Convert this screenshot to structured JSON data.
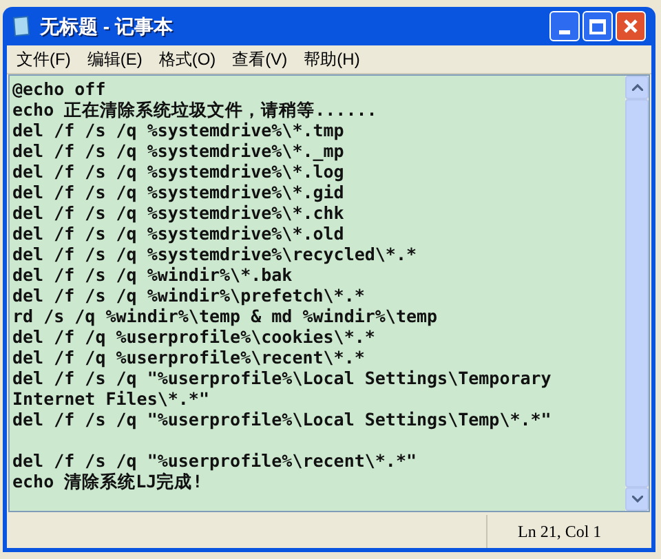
{
  "window": {
    "title": "无标题 - 记事本"
  },
  "menu": [
    {
      "label": "文件(F)"
    },
    {
      "label": "编辑(E)"
    },
    {
      "label": "格式(O)"
    },
    {
      "label": "查看(V)"
    },
    {
      "label": "帮助(H)"
    }
  ],
  "editor": {
    "lines": [
      {
        "kind": "code",
        "text": "@echo off"
      },
      {
        "kind": "code",
        "text": "echo 正在清除系统垃圾文件，请稍等......"
      },
      {
        "kind": "code",
        "text": "del /f /s /q %systemdrive%\\*.tmp"
      },
      {
        "kind": "code",
        "text": "del /f /s /q %systemdrive%\\*._mp"
      },
      {
        "kind": "code",
        "text": "del /f /s /q %systemdrive%\\*.log"
      },
      {
        "kind": "code",
        "text": "del /f /s /q %systemdrive%\\*.gid"
      },
      {
        "kind": "code",
        "text": "del /f /s /q %systemdrive%\\*.chk"
      },
      {
        "kind": "code",
        "text": "del /f /s /q %systemdrive%\\*.old"
      },
      {
        "kind": "code",
        "text": "del /f /s /q %systemdrive%\\recycled\\*.*"
      },
      {
        "kind": "code",
        "text": "del /f /s /q %windir%\\*.bak"
      },
      {
        "kind": "code",
        "text": "del /f /s /q %windir%\\prefetch\\*.*"
      },
      {
        "kind": "code",
        "text": "rd /s /q %windir%\\temp & md %windir%\\temp"
      },
      {
        "kind": "code",
        "text": "del /f /q %userprofile%\\cookies\\*.*"
      },
      {
        "kind": "code",
        "text": "del /f /q %userprofile%\\recent\\*.*"
      },
      {
        "kind": "code",
        "text": "del /f /s /q \"%userprofile%\\Local Settings\\Temporary Internet Files\\*.*\""
      },
      {
        "kind": "code",
        "text": "del /f /s /q \"%userprofile%\\Local Settings\\Temp\\*.*\""
      },
      {
        "kind": "blank"
      },
      {
        "kind": "code",
        "text": "del /f /s /q \"%userprofile%\\recent\\*.*\""
      },
      {
        "kind": "code",
        "text": "echo 清除系统LJ完成!"
      }
    ]
  },
  "status_bar": {
    "position": "Ln 21, Col 1"
  }
}
